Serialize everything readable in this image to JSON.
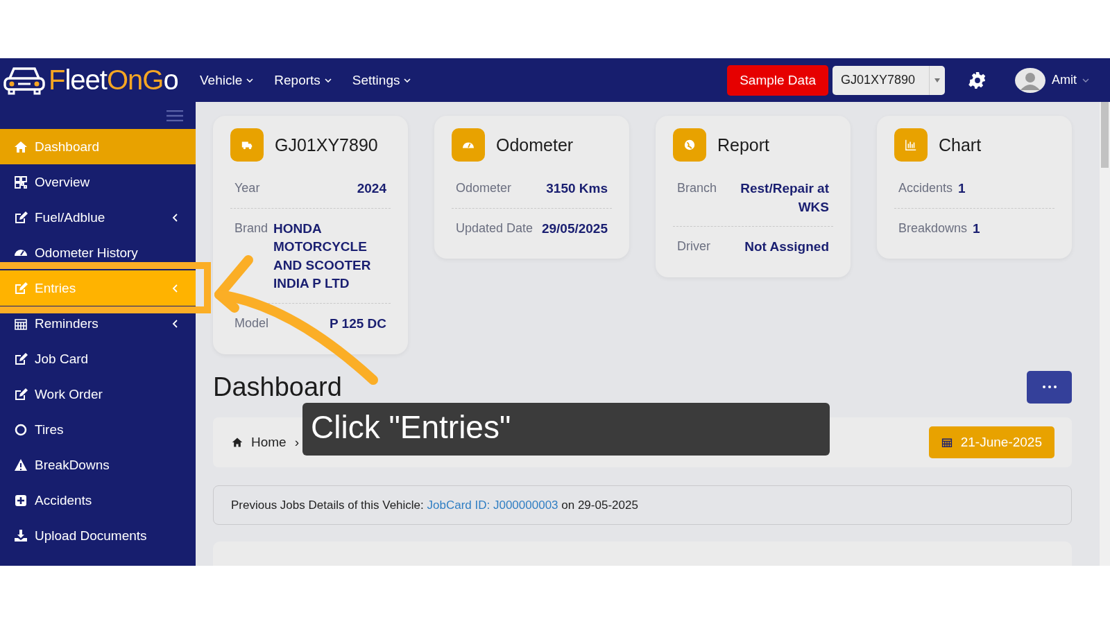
{
  "header": {
    "logo": [
      {
        "text": "F",
        "color": "#f5a623"
      },
      {
        "text": "leet",
        "color": "#ffffff"
      },
      {
        "text": "OnG",
        "color": "#f5a623"
      },
      {
        "text": "o",
        "color": "#ffffff"
      }
    ],
    "nav": [
      "Vehicle",
      "Reports",
      "Settings"
    ],
    "sample_button": "Sample Data",
    "vehicle_select": {
      "value": "GJ01XY7890"
    },
    "user": "Amit"
  },
  "sidebar": {
    "items": [
      {
        "label": "Dashboard",
        "selected": true,
        "highlighted": false,
        "submenu": false
      },
      {
        "label": "Overview",
        "selected": false,
        "highlighted": false,
        "submenu": false
      },
      {
        "label": "Fuel/Adblue",
        "selected": false,
        "highlighted": false,
        "submenu": true
      },
      {
        "label": "Odometer History",
        "selected": false,
        "highlighted": false,
        "submenu": false
      },
      {
        "label": "Entries",
        "selected": false,
        "highlighted": true,
        "submenu": true
      },
      {
        "label": "Reminders",
        "selected": false,
        "highlighted": false,
        "submenu": true
      },
      {
        "label": "Job Card",
        "selected": false,
        "highlighted": false,
        "submenu": false
      },
      {
        "label": "Work Order",
        "selected": false,
        "highlighted": false,
        "submenu": false
      },
      {
        "label": "Tires",
        "selected": false,
        "highlighted": false,
        "submenu": false
      },
      {
        "label": "BreakDowns",
        "selected": false,
        "highlighted": false,
        "submenu": false
      },
      {
        "label": "Accidents",
        "selected": false,
        "highlighted": false,
        "submenu": false
      },
      {
        "label": "Upload Documents",
        "selected": false,
        "highlighted": false,
        "submenu": false
      }
    ]
  },
  "cards": [
    {
      "title": "GJ01XY7890",
      "kind": "pairs",
      "rows": [
        {
          "label": "Year",
          "value": "2024"
        },
        {
          "label": "Brand",
          "value": "HONDA MOTORCYCLE AND SCOOTER INDIA P LTD"
        },
        {
          "label": "Model",
          "value": "P 125 DC"
        }
      ]
    },
    {
      "title": "Odometer",
      "kind": "pairs",
      "rows": [
        {
          "label": "Odometer",
          "value": "3150 Kms"
        },
        {
          "label": "Updated Date",
          "value": "29/05/2025"
        }
      ]
    },
    {
      "title": "Report",
      "kind": "pairs",
      "rows": [
        {
          "label": "Branch",
          "value": "Rest/Repair at WKS"
        },
        {
          "label": "Driver",
          "value": "Not Assigned"
        }
      ]
    },
    {
      "title": "Chart",
      "kind": "inline",
      "rows": [
        {
          "label": "Accidents",
          "value": "1"
        },
        {
          "label": "Breakdowns",
          "value": "1"
        }
      ]
    }
  ],
  "page_title": "Dashboard",
  "breadcrumb": {
    "home": "Home",
    "separator": "›"
  },
  "date_button": "21-June-2025",
  "notice": {
    "prefix": "Previous Jobs Details of this Vehicle:",
    "link": "JobCard ID: J000000003",
    "suffix": "on 29-05-2025"
  },
  "tutorial": {
    "caption": "Click \"Entries\""
  }
}
